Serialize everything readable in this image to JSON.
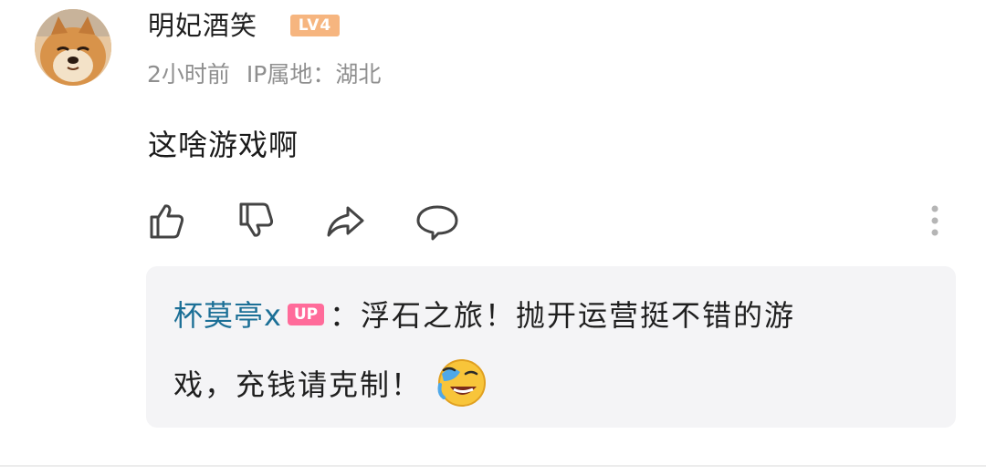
{
  "comment": {
    "username": "明妃酒笑",
    "level_badge": "LV4",
    "time": "2小时前",
    "ip_location": "IP属地：湖北",
    "text": "这啥游戏啊"
  },
  "actions": {
    "icons": [
      "thumbs-up-icon",
      "thumbs-down-icon",
      "share-icon",
      "reply-icon",
      "more-icon"
    ]
  },
  "reply": {
    "username": "杯莫亭x",
    "up_badge": "UP",
    "line1": "：浮石之旅！抛开运营挺不错的游",
    "line2": "戏，充钱请克制！",
    "emoji": "laughing-cry-emoji"
  },
  "colors": {
    "username_link": "#1b6f96",
    "up_badge": "#ff6b9a",
    "level_badge": "#f6b57f",
    "meta_text": "#8f8f8f"
  }
}
